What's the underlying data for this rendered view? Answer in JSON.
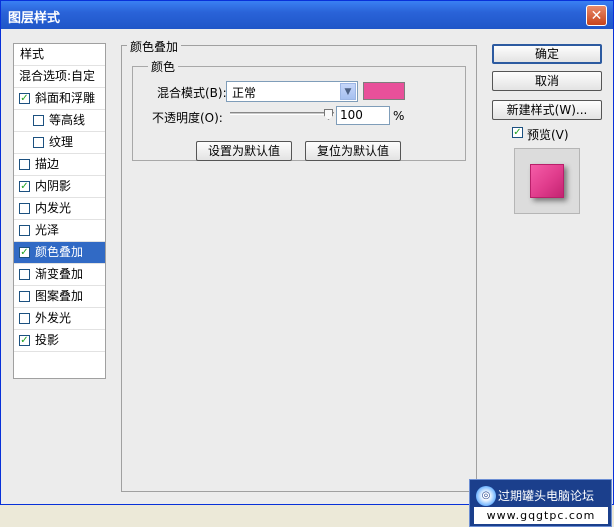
{
  "window": {
    "title": "图层样式",
    "close_glyph": "✕"
  },
  "style_list": {
    "header": "样式",
    "items": [
      {
        "label": "混合选项:自定",
        "checkbox": false,
        "checked": false,
        "indent": 0,
        "selected": false
      },
      {
        "label": "斜面和浮雕",
        "checkbox": true,
        "checked": true,
        "indent": 0,
        "selected": false
      },
      {
        "label": "等高线",
        "checkbox": true,
        "checked": false,
        "indent": 1,
        "selected": false
      },
      {
        "label": "纹理",
        "checkbox": true,
        "checked": false,
        "indent": 1,
        "selected": false
      },
      {
        "label": "描边",
        "checkbox": true,
        "checked": false,
        "indent": 0,
        "selected": false
      },
      {
        "label": "内阴影",
        "checkbox": true,
        "checked": true,
        "indent": 0,
        "selected": false
      },
      {
        "label": "内发光",
        "checkbox": true,
        "checked": false,
        "indent": 0,
        "selected": false
      },
      {
        "label": "光泽",
        "checkbox": true,
        "checked": false,
        "indent": 0,
        "selected": false
      },
      {
        "label": "颜色叠加",
        "checkbox": true,
        "checked": true,
        "indent": 0,
        "selected": true
      },
      {
        "label": "渐变叠加",
        "checkbox": true,
        "checked": false,
        "indent": 0,
        "selected": false
      },
      {
        "label": "图案叠加",
        "checkbox": true,
        "checked": false,
        "indent": 0,
        "selected": false
      },
      {
        "label": "外发光",
        "checkbox": true,
        "checked": false,
        "indent": 0,
        "selected": false
      },
      {
        "label": "投影",
        "checkbox": true,
        "checked": true,
        "indent": 0,
        "selected": false
      }
    ]
  },
  "panel": {
    "title": "颜色叠加",
    "group_title": "颜色",
    "blend_mode_label": "混合模式(B):",
    "blend_mode_value": "正常",
    "overlay_color": "#e8509a",
    "opacity_label": "不透明度(O):",
    "opacity_value": "100",
    "opacity_unit": "%",
    "opacity_level": 1.0,
    "set_default_button": "设置为默认值",
    "reset_default_button": "复位为默认值"
  },
  "actions": {
    "ok": "确定",
    "cancel": "取消",
    "new_style": "新建样式(W)...",
    "preview_label": "预览(V)",
    "preview_checked": true
  },
  "watermark": {
    "name": "过期罐头电脑论坛",
    "url": "www.gqgtpc.com"
  },
  "colors": {
    "title_bar": "#2a63d8",
    "selection": "#316ac5",
    "overlay": "#e8509a"
  },
  "icons": [
    "close-icon",
    "dropdown-arrow-icon",
    "checkbox-icon",
    "slider-thumb-icon",
    "forum-logo-icon"
  ]
}
